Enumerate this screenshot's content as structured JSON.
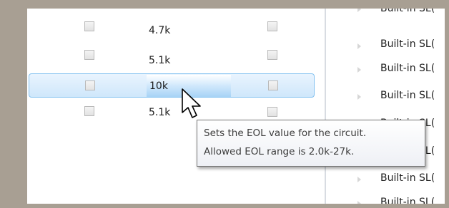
{
  "eol_table": {
    "rows": [
      {
        "value": "4.7k",
        "selected": false
      },
      {
        "value": "5.1k",
        "selected": false
      },
      {
        "value": "10k",
        "selected": true
      },
      {
        "value": "5.1k",
        "selected": false
      }
    ]
  },
  "device_tree": {
    "items": [
      {
        "label": "Built-in SL("
      },
      {
        "label": "Built-in SL("
      },
      {
        "label": "Built-in SL("
      },
      {
        "label": "Built-in SL("
      },
      {
        "label": "Built-in SL("
      },
      {
        "label": "Built-in SL("
      },
      {
        "label": "Built-in SL("
      },
      {
        "label": "Built-in SL("
      }
    ]
  },
  "tooltip": {
    "line1": "Sets the EOL value for the circuit.",
    "line2": "Allowed EOL range is 2.0k-27k."
  },
  "icons": {
    "cursor": "mouse-pointer-icon",
    "expander": "tree-expander-arrow-icon"
  },
  "colors": {
    "frame": "#a89f93",
    "selection_border": "#84c2f0",
    "selection_fill": "#cfe7fb"
  }
}
